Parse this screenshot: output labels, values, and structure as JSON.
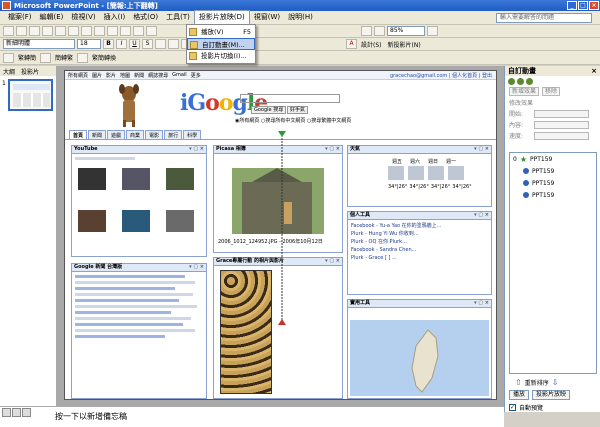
{
  "window": {
    "title": "Microsoft PowerPoint - [簡報:上下翻轉]"
  },
  "menubar": {
    "items": [
      "檔案(F)",
      "編輯(E)",
      "檢視(V)",
      "插入(I)",
      "格式(O)",
      "工具(T)",
      "投影片放映(D)",
      "視窗(W)",
      "說明(H)"
    ],
    "active_index": 6,
    "help_placeholder": "輸入需要解答的問題"
  },
  "toolbar": {
    "font_name": "新細明體",
    "font_size": "18",
    "zoom": "85%",
    "design_label": "設計(S)",
    "new_slide_label": "新投影片(N)",
    "row3_labels": [
      "繁轉簡",
      "簡轉繁",
      "繁簡轉換"
    ]
  },
  "dropdown": {
    "items": [
      {
        "label": "播放(V)",
        "shortcut": "F5"
      },
      {
        "label": "自訂動畫(M)...",
        "shortcut": ""
      },
      {
        "label": "投影片切換(I)...",
        "shortcut": ""
      }
    ],
    "highlighted_index": 1
  },
  "thumbs": {
    "tabs": [
      "大綱",
      "投影片"
    ],
    "slide_number": "1"
  },
  "slide": {
    "topbar_left": [
      "所有網頁",
      "圖片",
      "影片",
      "地圖",
      "新聞",
      "網誌搜尋",
      "Gmail",
      "更多"
    ],
    "topbar_right": "gracechao@gmail.com | 個人化首頁 | 登出",
    "logo": "iGoogle",
    "search_button": "Google 搜尋",
    "lucky_button": "好手氣",
    "radio_labels": "◉所有網頁 ○搜尋所有中文網頁 ○搜尋繁體中文網頁",
    "tabs": [
      "首頁",
      "新聞",
      "遊戲",
      "商業",
      "電影",
      "旅行",
      "科學"
    ],
    "gadgets": {
      "youtube": "YouTube",
      "picasa": "Picasa 相簿",
      "weather": "天氣",
      "personal": "個人工具",
      "news": "Google 新聞 台灣版",
      "grace": "Grace專屬行動 的相片與影片",
      "maps": "實用工具",
      "bottom": "",
      "picasa_caption": "2006_1012_124952.JPG - 2006年10月12日"
    },
    "weather_days": [
      "週五",
      "週六",
      "週日",
      "週一"
    ],
    "weather_temps": [
      "34°|26°",
      "34°|26°",
      "34°|26°",
      "34°|26°"
    ],
    "mail_lines": [
      "Facebook - Yu-a Yao 在你的塗鴉牆上...",
      "Plurk - Hung Yi Wu 你收到...",
      "Plurk - OQ 在你 Plurk...",
      "Facebook - Sandra Chen...",
      "Plurk - Grace [ ] ..."
    ]
  },
  "taskpane": {
    "title": "自訂動畫",
    "add_effect": "新增效果",
    "remove": "移除",
    "modify_label": "修改效果",
    "labels": [
      "開始:",
      "內容:",
      "速度:"
    ],
    "items": [
      {
        "num": "0",
        "name": "PPT159",
        "kind": "star"
      },
      {
        "num": "",
        "name": "PPT159",
        "kind": "dot"
      },
      {
        "num": "",
        "name": "PPT159",
        "kind": "dot"
      },
      {
        "num": "",
        "name": "PPT159",
        "kind": "dot"
      }
    ],
    "reorder": "重新排序",
    "play": "播放",
    "show": "投影片放映",
    "autopreview": "自動預覽"
  },
  "notes": {
    "placeholder": "按一下以新增備忘稿"
  },
  "colors": {
    "titlebar": "#1f5cc4",
    "highlight": "#c1d2ee"
  }
}
